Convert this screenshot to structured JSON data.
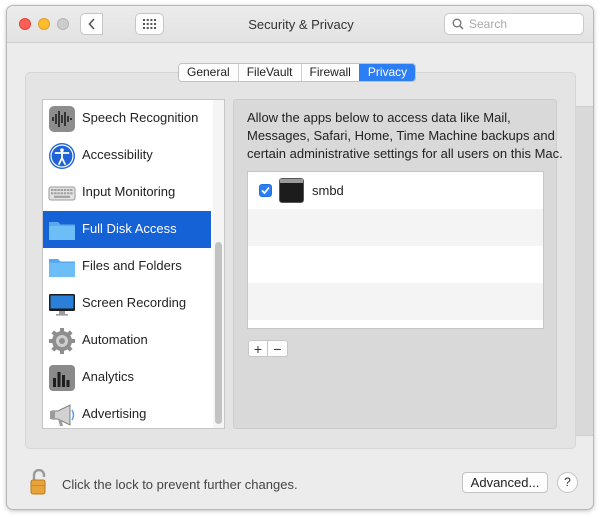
{
  "window": {
    "title": "Security & Privacy",
    "search": {
      "placeholder": "Search",
      "value": ""
    }
  },
  "tabs": [
    {
      "label": "General",
      "active": false
    },
    {
      "label": "FileVault",
      "active": false
    },
    {
      "label": "Firewall",
      "active": false
    },
    {
      "label": "Privacy",
      "active": true
    }
  ],
  "sidebar": {
    "items": [
      {
        "label": "Speech Recognition",
        "icon": "waveform-icon",
        "selected": false
      },
      {
        "label": "Accessibility",
        "icon": "accessibility-icon",
        "selected": false
      },
      {
        "label": "Input Monitoring",
        "icon": "keyboard-icon",
        "selected": false
      },
      {
        "label": "Full Disk Access",
        "icon": "folder-icon",
        "selected": true
      },
      {
        "label": "Files and Folders",
        "icon": "folder-icon",
        "selected": false
      },
      {
        "label": "Screen Recording",
        "icon": "monitor-icon",
        "selected": false
      },
      {
        "label": "Automation",
        "icon": "gear-icon",
        "selected": false
      },
      {
        "label": "Analytics",
        "icon": "chart-icon",
        "selected": false
      },
      {
        "label": "Advertising",
        "icon": "megaphone-icon",
        "selected": false
      }
    ]
  },
  "content": {
    "description_lines": [
      "Allow the apps below to access data like Mail,",
      "Messages, Safari, Home, Time Machine backups and",
      "certain administrative settings for all users on this Mac."
    ],
    "apps": [
      {
        "name": "smbd",
        "checked": true,
        "icon": "terminal-icon"
      }
    ],
    "add_label": "+",
    "remove_label": "−"
  },
  "footer": {
    "lock_text": "Click the lock to prevent further changes.",
    "advanced_label": "Advanced...",
    "help_label": "?"
  },
  "colors": {
    "accent": "#2c7ef5",
    "selection": "#1562d6",
    "window_bg": "#ececec"
  }
}
